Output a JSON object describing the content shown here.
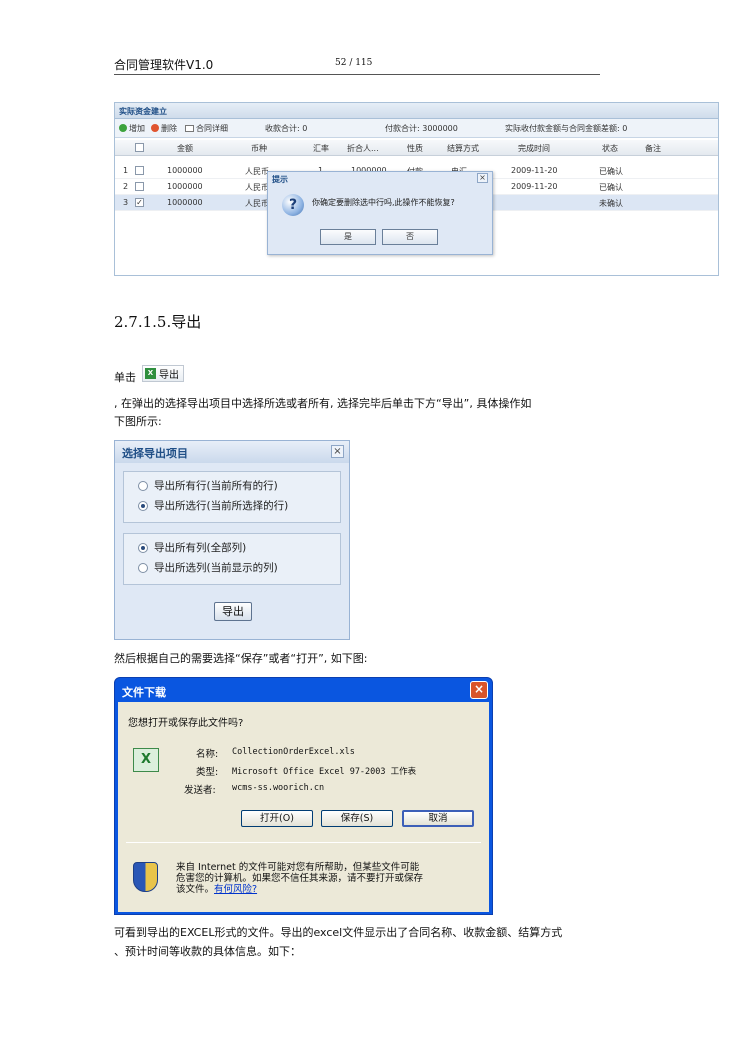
{
  "header": {
    "title": "合同管理软件V1.0",
    "page": "52 / 115"
  },
  "grid": {
    "title": "实际资金建立",
    "toolbar": {
      "add": "增加",
      "delete": "删除",
      "detail": "合同详细",
      "received_total": "收款合计: 0",
      "paid_total": "付款合计: 3000000",
      "diff": "实际收付款金额与合同金额差额: 0"
    },
    "columns": [
      "金额",
      "币种",
      "汇率",
      "折合人...",
      "性质",
      "结算方式",
      "完成时间",
      "状态",
      "备注"
    ],
    "rows": [
      {
        "num": "1",
        "checked": "",
        "amount": "1000000",
        "currency": "人民币",
        "rate": "1",
        "conv": "1000000",
        "nature": "付款",
        "settle": "电汇",
        "time": "2009-11-20",
        "status": "已确认"
      },
      {
        "num": "2",
        "checked": "",
        "amount": "1000000",
        "currency": "人民币",
        "rate": "",
        "conv": "",
        "nature": "",
        "settle": "",
        "time": "2009-11-20",
        "status": "已确认"
      },
      {
        "num": "3",
        "checked": "✓",
        "amount": "1000000",
        "currency": "人民币",
        "rate": "",
        "conv": "",
        "nature": "",
        "settle": "",
        "time": "",
        "status": "未确认"
      }
    ],
    "message_box": {
      "title": "提示",
      "text": "你确定要删除选中行吗,此操作不能恢复?",
      "yes": "是",
      "no": "否",
      "icon": "?",
      "close": "×"
    }
  },
  "section_heading": "2.7.1.5.导出",
  "para1": {
    "prefix": "单击",
    "button": "导出",
    "text_line1": ", 在弹出的选择导出项目中选择所选或者所有, 选择完毕后单击下方“导出”, 具体操作如",
    "text_line2": "下图所示:"
  },
  "export_dialog": {
    "title": "选择导出项目",
    "close": "×",
    "rows_options": [
      "导出所有行(当前所有的行)",
      "导出所选行(当前所选择的行)"
    ],
    "rows_selected": 1,
    "cols_options": [
      "导出所有列(全部列)",
      "导出所选列(当前显示的列)"
    ],
    "cols_selected": 0,
    "button": "导出"
  },
  "para2": "然后根据自己的需要选择“保存”或者“打开”, 如下图:",
  "download_dialog": {
    "title": "文件下载",
    "close": "×",
    "question": "您想打开或保存此文件吗?",
    "name_label": "名称:",
    "name_value": "CollectionOrderExcel.xls",
    "type_label": "类型:",
    "type_value": "Microsoft Office Excel 97-2003 工作表",
    "from_label": "发送者:",
    "from_value": "wcms-ss.woorich.cn",
    "open_btn": "打开(O)",
    "save_btn": "保存(S)",
    "cancel_btn": "取消",
    "warning_line1": "来自 Internet 的文件可能对您有所帮助，但某些文件可能",
    "warning_line2": "危害您的计算机。如果您不信任其来源，请不要打开或保存",
    "warning_line3": "该文件。",
    "risk_link": "有何风险?",
    "excel_glyph": "X"
  },
  "para3": {
    "line1": "可看到导出的EXCEL形式的文件。导出的excel文件显示出了合同名称、收款金额、结算方式",
    "line2": "、预计时间等收款的具体信息。如下："
  }
}
